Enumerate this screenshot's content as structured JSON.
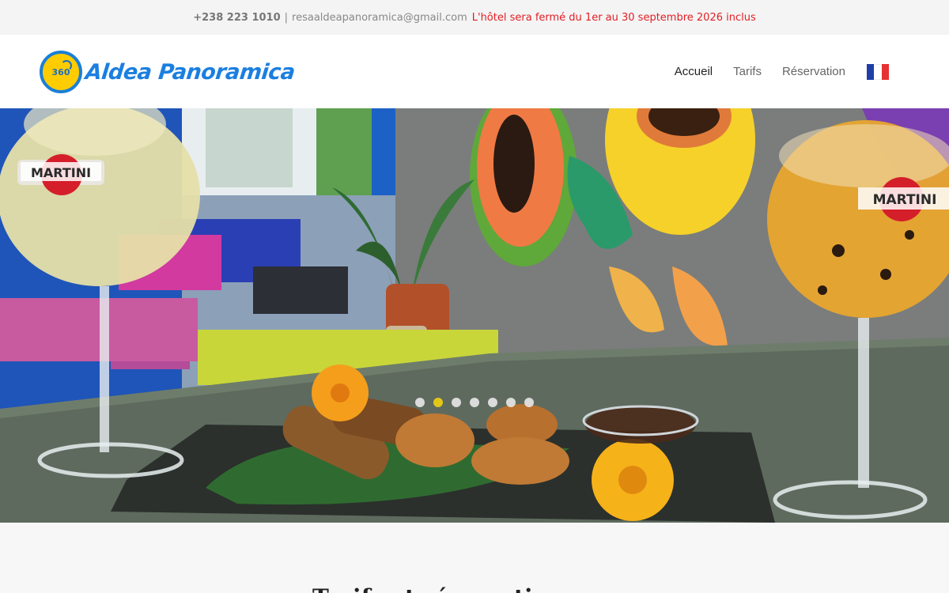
{
  "topbar": {
    "phone": "+238 223 1010",
    "separator": "|",
    "email": "resaaldeapanoramica@gmail.com",
    "notice": "L'hôtel sera fermé du 1er au 30 septembre 2026 inclus"
  },
  "header": {
    "logo_badge": "360",
    "logo_text": "Aldea Panoramica"
  },
  "nav": {
    "items": [
      {
        "label": "Accueil",
        "active": true
      },
      {
        "label": "Tarifs",
        "active": false
      },
      {
        "label": "Réservation",
        "active": false
      }
    ],
    "language_icon": "france-flag-icon"
  },
  "hero": {
    "glass_brand": "MARTINI",
    "slide_count": 7,
    "active_slide": 2
  },
  "section": {
    "title": "Tarifs et réservations"
  },
  "colors": {
    "accent_notice": "#e31e24",
    "logo_blue": "#1b7fe0",
    "logo_yellow": "#ffcc00",
    "dot_active": "#f2d10f"
  }
}
